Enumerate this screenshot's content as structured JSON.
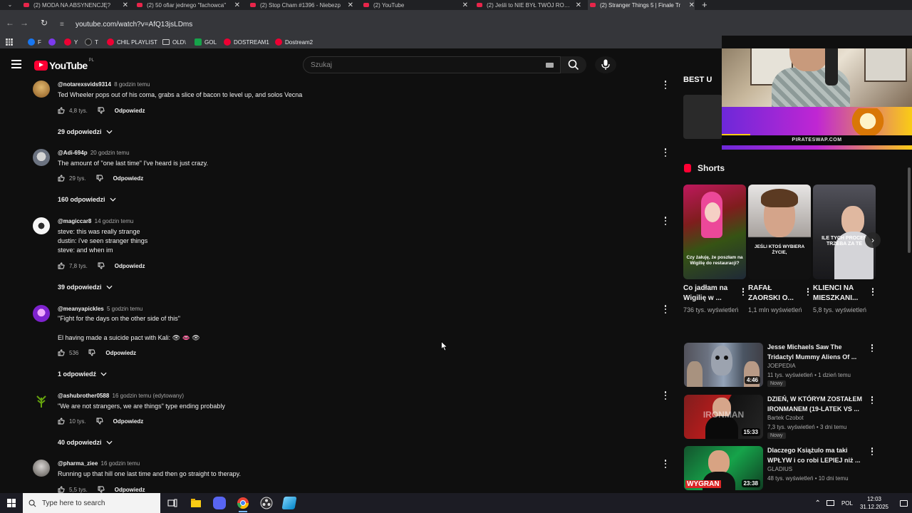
{
  "browser": {
    "tabs": [
      {
        "title": "(2) MODA NA ABSYNENCJĘ?",
        "active": false
      },
      {
        "title": "(2) 50 ofiar jednego \"fachowca\"",
        "active": false
      },
      {
        "title": "(2) Stop Cham #1396 - Niebezp",
        "active": false
      },
      {
        "title": "(2) YouTube",
        "active": false
      },
      {
        "title": "(2) Jeśli to NIE BYŁ TWÓJ ROK c",
        "active": false
      },
      {
        "title": "(2) Stranger Things 5 | Finale Tr",
        "active": true
      }
    ],
    "new_tab": "+",
    "url": "youtube.com/watch?v=AfQ13jsLDms",
    "bookmarks": [
      {
        "label": "F",
        "icon": "facebook-icon"
      },
      {
        "label": "",
        "icon": "twitch-icon"
      },
      {
        "label": "Y",
        "icon": "youtube-icon"
      },
      {
        "label": "T",
        "icon": "x-icon"
      },
      {
        "label": "CHIL PLAYLIST",
        "icon": "youtube-icon"
      },
      {
        "label": "OLD\\",
        "icon": "folder-icon"
      },
      {
        "label": "GOL",
        "icon": "gol-icon"
      },
      {
        "label": "DOSTREAM1",
        "icon": "youtube-icon"
      },
      {
        "label": "Dostream2",
        "icon": "youtube-icon"
      }
    ]
  },
  "youtube": {
    "logo": "YouTube",
    "region": "PL",
    "search_placeholder": "Szukaj"
  },
  "comments": [
    {
      "author": "@notarexsvids9314",
      "time": "8 godzin temu",
      "lines": [
        "Ted Wheeler pops out of his coma, grabs a slice of bacon to level up, and solos Vecna"
      ],
      "likes": "4,8 tys.",
      "reply": "Odpowiedz",
      "replies": "29 odpowiedzi",
      "avatar_color": "#b8863b"
    },
    {
      "author": "@Adi-694p",
      "time": "20 godzin temu",
      "lines": [
        "The amount of \"one last time\" I've heard is just crazy."
      ],
      "likes": "29 tys.",
      "reply": "Odpowiedz",
      "replies": "160 odpowiedzi",
      "avatar_color": "#9ca3af"
    },
    {
      "author": "@magiccar8",
      "time": "14 godzin temu",
      "lines": [
        "steve: this was really strange",
        "dustin: i've seen stranger things",
        "steve: and when im"
      ],
      "likes": "7,8 tys.",
      "reply": "Odpowiedz",
      "replies": "39 odpowiedzi",
      "avatar_color": "#e5e5e5"
    },
    {
      "author": "@meanyapickles",
      "time": "5 godzin temu",
      "lines": [
        "\"Fight for the days on the other side of this\"",
        "",
        "El having made a suicide pact with Kali: 👁 👄 👁"
      ],
      "likes": "536",
      "reply": "Odpowiedz",
      "replies": "1 odpowiedź",
      "avatar_color": "#c084fc"
    },
    {
      "author": "@ashubrother0588",
      "time": "16 godzin temu (edytowany)",
      "lines": [
        "\"We are not strangers, we are things\" type ending probably"
      ],
      "likes": "10 tys.",
      "reply": "Odpowiedz",
      "replies": "40 odpowiedzi",
      "avatar_color": "#4d7c0f"
    },
    {
      "author": "@pharma_ziee",
      "time": "16 godzin temu",
      "lines": [
        "Running up that hill one last time and then go straight to therapy."
      ],
      "likes": "5,5 tys.",
      "reply": "Odpowiedz",
      "replies": "",
      "avatar_color": "#a3a3a3"
    }
  ],
  "sidebar": {
    "ad_label": "BEST U",
    "stream_banner": "PIRATESWAP.COM",
    "shorts_title": "Shorts",
    "shorts": [
      {
        "title": "Co jadłam na Wigilię w ...",
        "views": "736 tys. wyświetleń",
        "caption": "Czy żałuję, że poszłam na Wigilię do restauracji?",
        "color_a": "#9f1239",
        "color_b": "#1f2937"
      },
      {
        "title": "RAFAŁ ZAORSKI O...",
        "views": "1,1 mln wyświetleń",
        "caption": "JEŚLI KTOŚ WYBIERA ŻYCIE,",
        "color_a": "#d6cfc4",
        "color_b": "#141414"
      },
      {
        "title": "KLIENCI NA MIESZKANI...",
        "views": "5,8 tys. wyświetleń",
        "caption": "ILE TYCH PROCEN TRZEBA ZA TE",
        "color_a": "#3f3f46",
        "color_b": "#18181b"
      }
    ],
    "videos": [
      {
        "title": "Jesse Michaels Saw The Tridactyl Mummy Aliens Of ...",
        "channel": "JOEPEDIA",
        "meta": "11 tys. wyświetleń • 1 dzień temu",
        "badge": "Nowy",
        "duration": "4:46",
        "color_a": "#3b3b3b",
        "color_b": "#7aa2c8"
      },
      {
        "title": "DZIEŃ, W KTÓRYM ZOSTAŁEM IRONMANEM (19-LATEK VS ...",
        "channel": "Bartek Czobot",
        "meta": "7,3 tys. wyświetleń • 3 dni temu",
        "badge": "Nowy",
        "duration": "15:33",
        "color_a": "#b91c1c",
        "color_b": "#1f1f1f"
      },
      {
        "title": "Dlaczego Książulo ma taki WPŁYW i co robi LEPIEJ niż ...",
        "channel": "GLADIUS",
        "meta": "48 tys. wyświetleń • 10 dni temu",
        "badge": "",
        "duration": "23:38",
        "color_a": "#16a34a",
        "color_b": "#0f3d22",
        "overlay": "WYGRAN"
      }
    ]
  },
  "taskbar": {
    "search_placeholder": "Type here to search",
    "language": "POL",
    "time": "12:03",
    "date": "31.12.2025"
  }
}
